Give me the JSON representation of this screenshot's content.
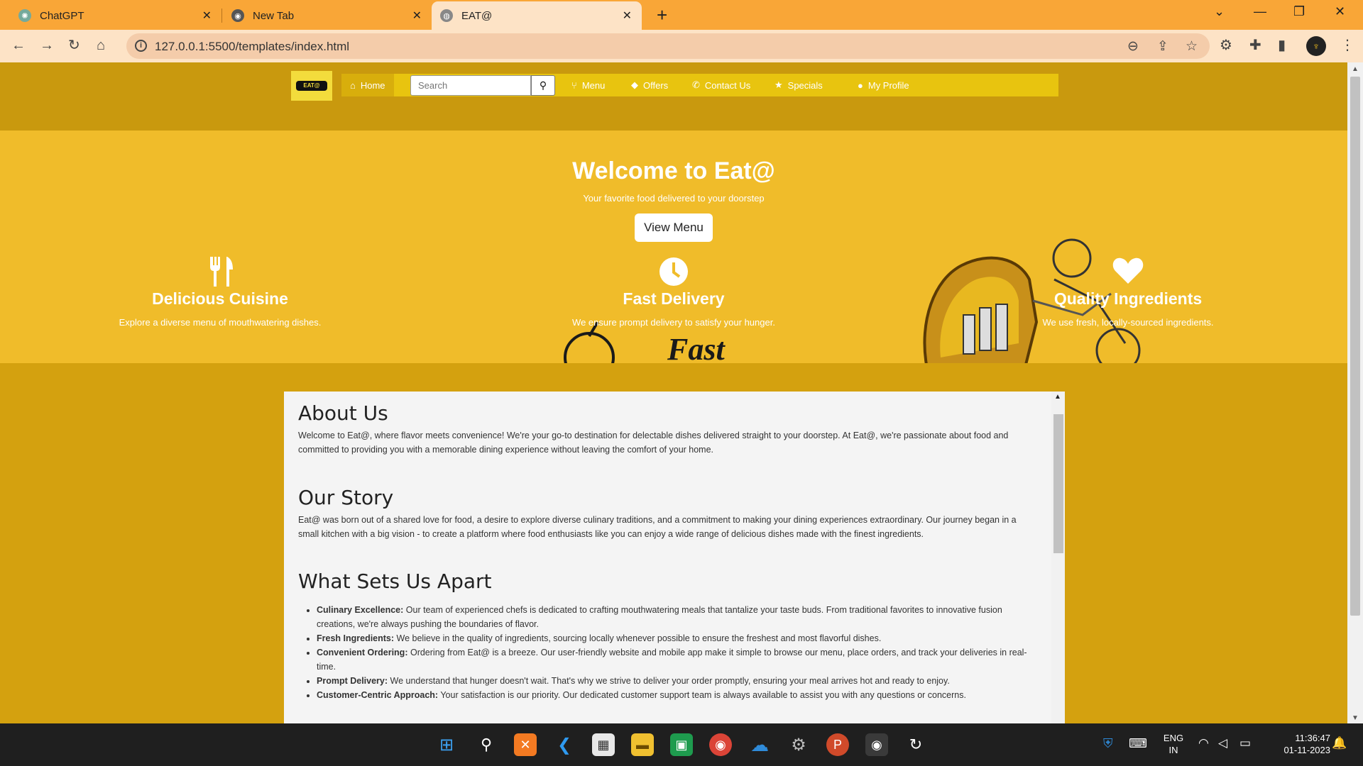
{
  "browser": {
    "tabs": [
      {
        "label": "ChatGPT",
        "icon": "chatgpt-icon"
      },
      {
        "label": "New Tab",
        "icon": "chrome-icon"
      },
      {
        "label": "EAT@",
        "icon": "globe-icon"
      }
    ],
    "url": "127.0.0.1:5500/templates/index.html"
  },
  "nav": {
    "logo_text": "EAT@",
    "home": "Home",
    "search_placeholder": "Search",
    "menu": "Menu",
    "offers": "Offers",
    "contact": "Contact Us",
    "specials": "Specials",
    "profile": "My Profile"
  },
  "hero": {
    "title": "Welcome to Eat@",
    "subtitle": "Your favorite food delivered to your doorstep",
    "button": "View Menu",
    "fast_word": "Fast",
    "features": [
      {
        "title": "Delicious Cuisine",
        "desc": "Explore a diverse menu of mouthwatering dishes.",
        "icon": "utensils-icon"
      },
      {
        "title": "Fast Delivery",
        "desc": "We ensure prompt delivery to satisfy your hunger.",
        "icon": "clock-icon"
      },
      {
        "title": "Quality Ingredients",
        "desc": "We use fresh, locally-sourced ingredients.",
        "icon": "heart-icon"
      }
    ]
  },
  "about": {
    "title": "About Us",
    "text": "Welcome to Eat@, where flavor meets convenience! We're your go-to destination for delectable dishes delivered straight to your doorstep. At Eat@, we're passionate about food and committed to providing you with a memorable dining experience without leaving the comfort of your home.",
    "story_title": "Our Story",
    "story_text": "Eat@ was born out of a shared love for food, a desire to explore diverse culinary traditions, and a commitment to making your dining experiences extraordinary. Our journey began in a small kitchen with a big vision - to create a platform where food enthusiasts like you can enjoy a wide range of delicious dishes made with the finest ingredients.",
    "apart_title": "What Sets Us Apart",
    "points": [
      {
        "label": "Culinary Excellence:",
        "text": "Our team of experienced chefs is dedicated to crafting mouthwatering meals that tantalize your taste buds. From traditional favorites to innovative fusion creations, we're always pushing the boundaries of flavor."
      },
      {
        "label": "Fresh Ingredients:",
        "text": "We believe in the quality of ingredients, sourcing locally whenever possible to ensure the freshest and most flavorful dishes."
      },
      {
        "label": "Convenient Ordering:",
        "text": "Ordering from Eat@ is a breeze. Our user-friendly website and mobile app make it simple to browse our menu, place orders, and track your deliveries in real-time."
      },
      {
        "label": "Prompt Delivery:",
        "text": "We understand that hunger doesn't wait. That's why we strive to deliver your order promptly, ensuring your meal arrives hot and ready to enjoy."
      },
      {
        "label": "Customer-Centric Approach:",
        "text": "Your satisfaction is our priority. Our dedicated customer support team is always available to assist you with any questions or concerns."
      }
    ]
  },
  "taskbar": {
    "lang_top": "ENG",
    "lang_bottom": "IN",
    "time": "11:36:47",
    "date": "01-11-2023"
  }
}
